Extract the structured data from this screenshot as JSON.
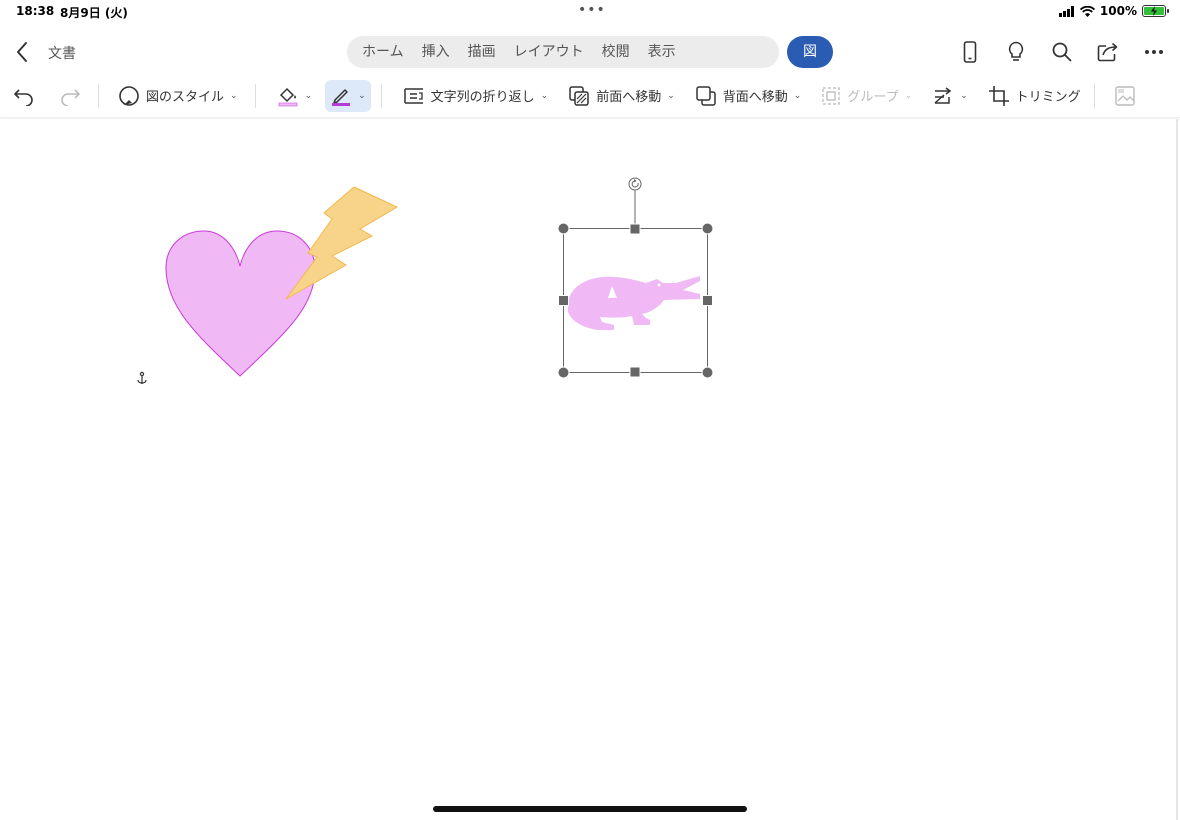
{
  "status_bar": {
    "time": "18:38",
    "date": "8月9日 (火)",
    "battery_percent": "100%"
  },
  "header": {
    "doc_title": "文書",
    "tabs": [
      {
        "label": "ホーム"
      },
      {
        "label": "挿入"
      },
      {
        "label": "描画"
      },
      {
        "label": "レイアウト"
      },
      {
        "label": "校閲"
      },
      {
        "label": "表示"
      }
    ],
    "active_tab": "図",
    "active_color": "#2b5cb3",
    "right_icons": [
      "phone-view-icon",
      "lightbulb-icon",
      "search-icon",
      "share-icon",
      "more-icon"
    ]
  },
  "ribbon": {
    "picture_styles": "図のスタイル",
    "wrap_text": "文字列の折り返し",
    "bring_forward": "前面へ移動",
    "send_backward": "背面へ移動",
    "group": "グループ",
    "crop": "トリミング"
  },
  "canvas": {
    "shapes": [
      "heart",
      "lightning-bolt",
      "crocodile"
    ],
    "heart_fill": "#f0b9f5",
    "heart_stroke": "#c93bd6",
    "bolt_fill": "#f8d38a",
    "bolt_stroke": "#f0b84c",
    "crocodile_fill": "#f0b9f5",
    "selection_handle_color": "#666666"
  }
}
